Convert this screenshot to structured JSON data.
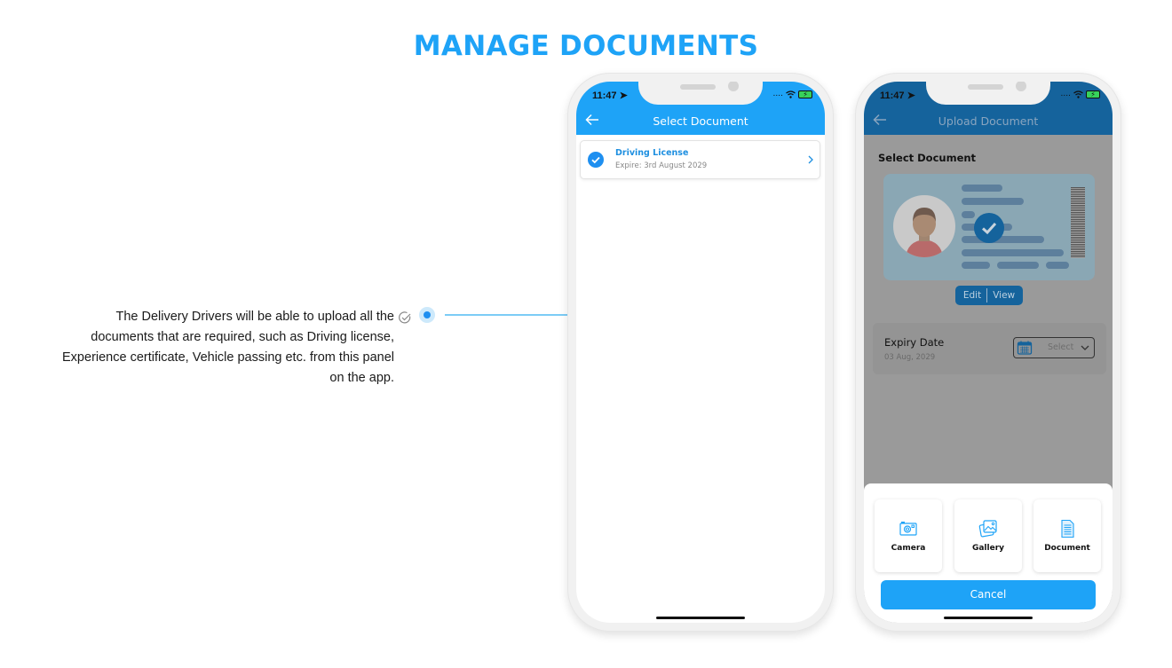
{
  "page": {
    "title": "MANAGE DOCUMENTS",
    "description": "The Delivery Drivers will be able to upload all the documents that are required, such as Driving license, Experience certificate, Vehicle passing etc. from this panel on the app."
  },
  "colors": {
    "accent": "#1ea3f7",
    "header_dimmed": "#15639c",
    "connector": "#7cccf6"
  },
  "phone1": {
    "status": {
      "time": "11:47",
      "signal": "....",
      "icons": [
        "location-arrow-icon",
        "wifi-icon",
        "battery-charging-icon"
      ]
    },
    "header": {
      "title": "Select Document",
      "back_icon": "arrow-left-icon"
    },
    "documents": [
      {
        "name": "Driving License",
        "expire": "Expire: 3rd August 2029",
        "status_icon": "check-circle-icon"
      }
    ]
  },
  "phone2": {
    "status": {
      "time": "11:47",
      "signal": "....",
      "icons": [
        "location-arrow-icon",
        "wifi-icon",
        "battery-charging-icon"
      ]
    },
    "header": {
      "title": "Upload Document",
      "back_icon": "arrow-left-icon"
    },
    "select_document_label": "Select Document",
    "edit_label": "Edit",
    "view_label": "View",
    "expiry": {
      "label": "Expiry Date",
      "value": "03 Aug, 2029",
      "select_placeholder": "Select"
    },
    "sheet": {
      "options": [
        {
          "label": "Camera",
          "icon": "camera-icon"
        },
        {
          "label": "Gallery",
          "icon": "gallery-icon"
        },
        {
          "label": "Document",
          "icon": "document-icon"
        }
      ],
      "cancel_label": "Cancel"
    }
  }
}
